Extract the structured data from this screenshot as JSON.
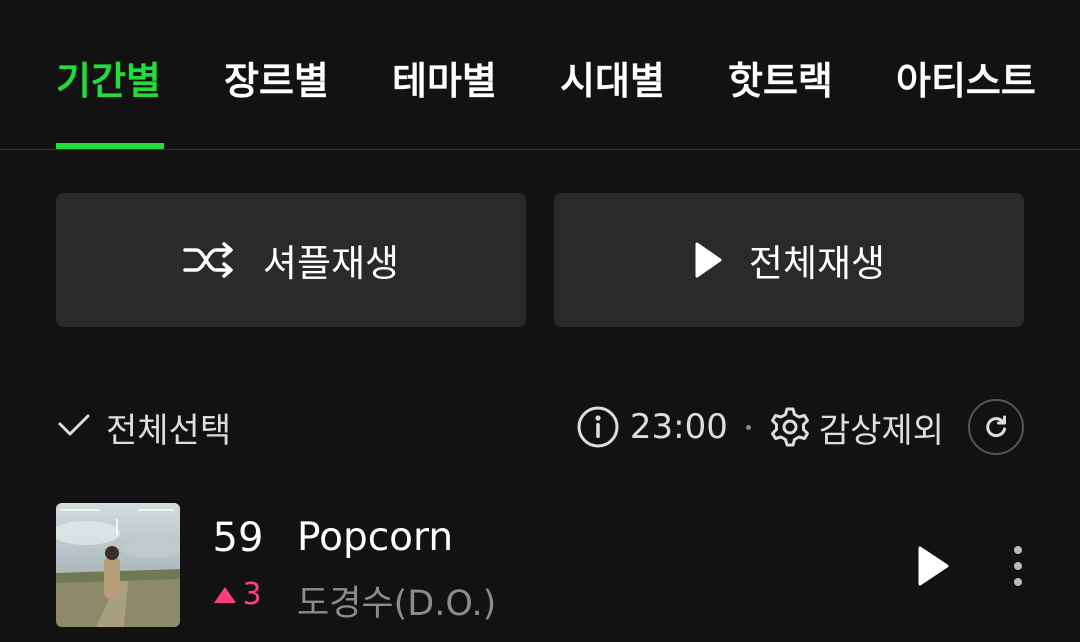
{
  "tabs": [
    {
      "label": "기간별",
      "active": true
    },
    {
      "label": "장르별",
      "active": false
    },
    {
      "label": "테마별",
      "active": false
    },
    {
      "label": "시대별",
      "active": false
    },
    {
      "label": "핫트랙",
      "active": false
    },
    {
      "label": "아티스트",
      "active": false
    }
  ],
  "actions": {
    "shuffle_label": "셔플재생",
    "play_all_label": "전체재생"
  },
  "toolbar": {
    "select_all_label": "전체선택",
    "time": "23:00",
    "exclude_label": "감상제외"
  },
  "songs": [
    {
      "rank": "59",
      "rank_change": "3",
      "rank_direction": "up",
      "title": "Popcorn",
      "artist": "도경수(D.O.)"
    }
  ],
  "colors": {
    "accent": "#22dc3c",
    "rank_up": "#ff3d7f",
    "background": "#121212",
    "button_bg": "#2a2a2a"
  }
}
